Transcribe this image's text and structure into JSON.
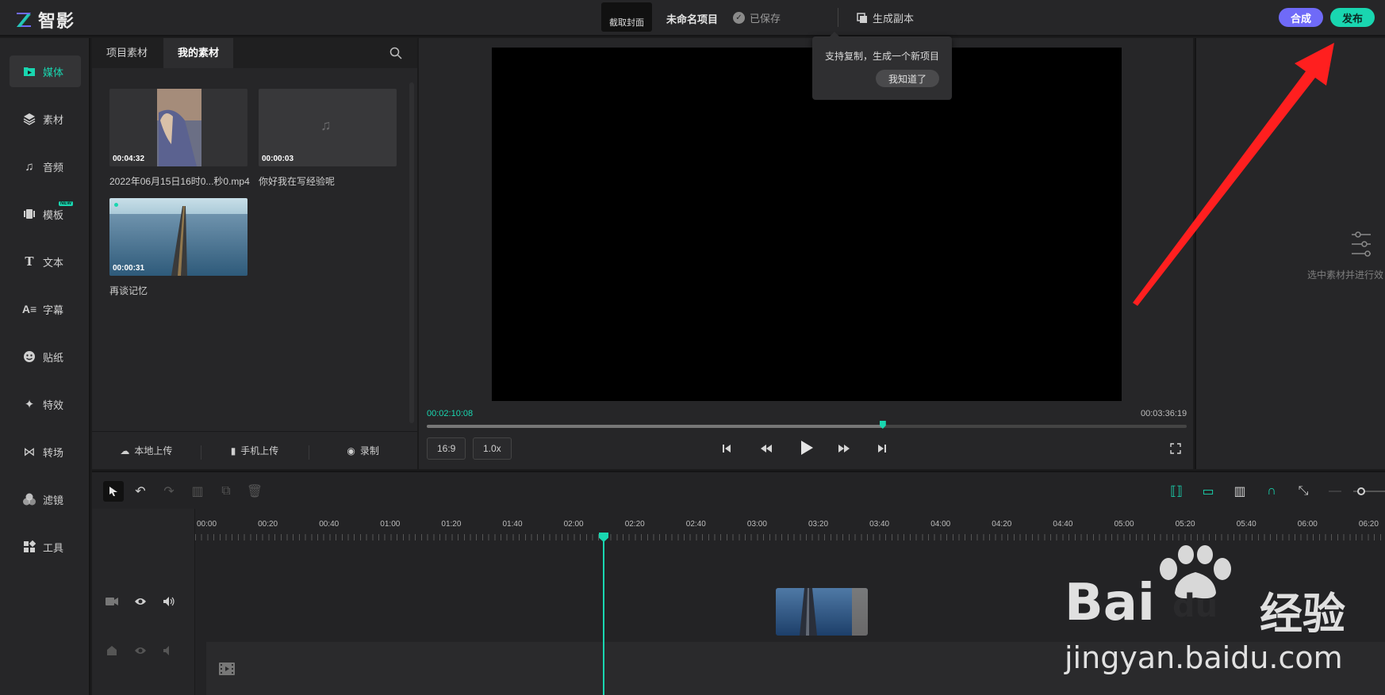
{
  "app": {
    "logo_text": "智影",
    "cover_label": "截取封面",
    "project_name": "未命名项目",
    "save_status": "已保存",
    "duplicate_label": "生成副本",
    "compose_label": "合成",
    "publish_label": "发布",
    "colors": {
      "accent": "#19d6b0",
      "compose": "#6f6af8"
    }
  },
  "nav": {
    "items": [
      {
        "label": "媒体",
        "icon": "media-icon",
        "active": true
      },
      {
        "label": "素材",
        "icon": "layers-icon"
      },
      {
        "label": "音频",
        "icon": "music-note-icon"
      },
      {
        "label": "模板",
        "icon": "template-icon",
        "badge": "NEW"
      },
      {
        "label": "文本",
        "icon": "text-icon"
      },
      {
        "label": "字幕",
        "icon": "subtitle-icon"
      },
      {
        "label": "贴纸",
        "icon": "sticker-icon"
      },
      {
        "label": "特效",
        "icon": "sparkle-icon"
      },
      {
        "label": "转场",
        "icon": "transition-icon"
      },
      {
        "label": "滤镜",
        "icon": "filter-icon"
      },
      {
        "label": "工具",
        "icon": "tools-icon"
      }
    ]
  },
  "media": {
    "tabs": [
      "项目素材",
      "我的素材"
    ],
    "active_tab": 1,
    "items": [
      {
        "duration": "00:04:32",
        "name": "2022年06月15日16时0...秒0.mp4",
        "kind": "video"
      },
      {
        "duration": "00:00:03",
        "name": "你好我在写经验呢",
        "kind": "audio"
      },
      {
        "duration": "00:00:31",
        "name": "再谈记忆",
        "kind": "video"
      }
    ],
    "footer": {
      "local_upload": "本地上传",
      "phone_upload": "手机上传",
      "record": "录制"
    }
  },
  "preview": {
    "current_time": "00:02:10:08",
    "total_time": "00:03:36:19",
    "progress": 0.6,
    "ratio": "16:9",
    "speed": "1.0x"
  },
  "popover": {
    "message": "支持复制，生成一个新项目",
    "ok_label": "我知道了"
  },
  "right_panel": {
    "hint": "选中素材并进行效"
  },
  "timeline": {
    "ticks": [
      "00:00",
      "00:20",
      "00:40",
      "01:00",
      "01:20",
      "01:40",
      "02:00",
      "02:20",
      "02:40",
      "03:00",
      "03:20",
      "03:40",
      "04:00",
      "04:20",
      "04:40",
      "05:00",
      "05:20",
      "05:40",
      "06:00",
      "06:20"
    ]
  },
  "watermark": {
    "brand": "Bai",
    "brand2": "du",
    "brand_cn": "经验",
    "url": "jingyan.baidu.com"
  }
}
